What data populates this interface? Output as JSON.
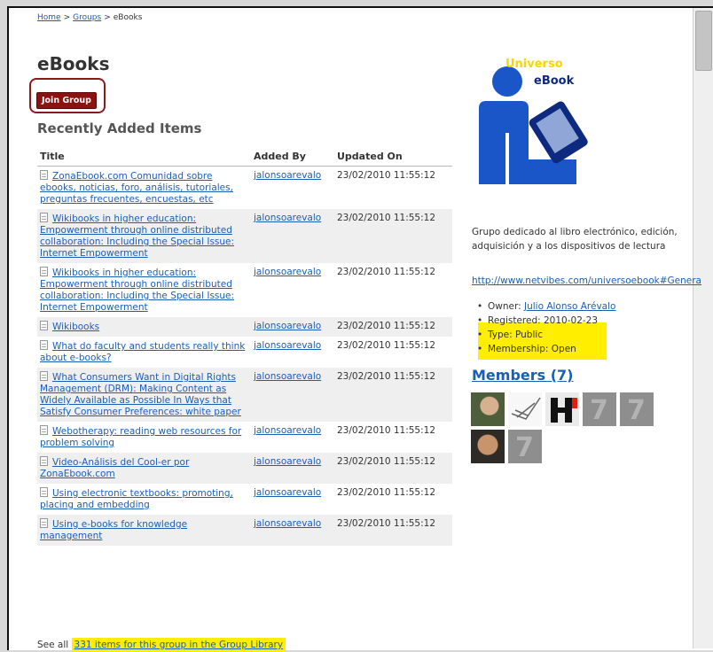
{
  "breadcrumb": {
    "home": "Home",
    "separator": ">",
    "groups": "Groups",
    "current": "eBooks"
  },
  "page_title": "eBooks",
  "join_button": "Join Group",
  "section_title": "Recently Added Items",
  "table": {
    "columns": [
      "Title",
      "Added By",
      "Updated On"
    ],
    "rows": [
      {
        "title": "ZonaEbook.com Comunidad sobre ebooks, noticias, foro, análisis, tutoriales, preguntas frecuentes, encuestas, etc",
        "added_by": "jalonsoarevalo",
        "updated_on": "23/02/2010 11:55:12"
      },
      {
        "title": "Wikibooks in higher education: Empowerment through online distributed collaboration: Including the Special Issue: Internet Empowerment",
        "added_by": "jalonsoarevalo",
        "updated_on": "23/02/2010 11:55:12"
      },
      {
        "title": "Wikibooks in higher education: Empowerment through online distributed collaboration: Including the Special Issue: Internet Empowerment",
        "added_by": "jalonsoarevalo",
        "updated_on": "23/02/2010 11:55:12"
      },
      {
        "title": "Wikibooks",
        "added_by": "jalonsoarevalo",
        "updated_on": "23/02/2010 11:55:12"
      },
      {
        "title": "What do faculty and students really think about e-books?",
        "added_by": "jalonsoarevalo",
        "updated_on": "23/02/2010 11:55:12"
      },
      {
        "title": "What Consumers Want in Digital Rights Management (DRM): Making Content as Widely Available as Possible In Ways that Satisfy Consumer Preferences: white paper",
        "added_by": "jalonsoarevalo",
        "updated_on": "23/02/2010 11:55:12"
      },
      {
        "title": "Webotherapy: reading web resources for problem solving",
        "added_by": "jalonsoarevalo",
        "updated_on": "23/02/2010 11:55:12"
      },
      {
        "title": "Video-Análisis del Cool-er por ZonaEbook.com",
        "added_by": "jalonsoarevalo",
        "updated_on": "23/02/2010 11:55:12"
      },
      {
        "title": "Using electronic textbooks: promoting, placing and embedding",
        "added_by": "jalonsoarevalo",
        "updated_on": "23/02/2010 11:55:12"
      },
      {
        "title": "Using e-books for knowledge management",
        "added_by": "jalonsoarevalo",
        "updated_on": "23/02/2010 11:55:12"
      }
    ]
  },
  "see_all": {
    "prefix": "See all",
    "link": "331 items for this group in the Group Library"
  },
  "sidebar": {
    "logo": {
      "line1": "Universo",
      "line2": "eBook",
      "colors": {
        "figure": "#1a56c8",
        "text_dark": "#0d2a80",
        "text_light": "#f4d800"
      }
    },
    "description": "Grupo dedicado al libro electrónico, edición, adquisición y a los dispositivos de lectura",
    "url": "http://www.netvibes.com/universoebook#Genera",
    "owner_label": "Owner:",
    "owner_name": "Julio Alonso Arévalo",
    "registered": "Registered: 2010-02-23",
    "type": "Type: Public",
    "membership": "Membership: Open",
    "members_title": "Members (7)"
  },
  "colors": {
    "link": "#1a5fb4",
    "join_button": "#8c1111",
    "highlight": "#ffee00"
  }
}
